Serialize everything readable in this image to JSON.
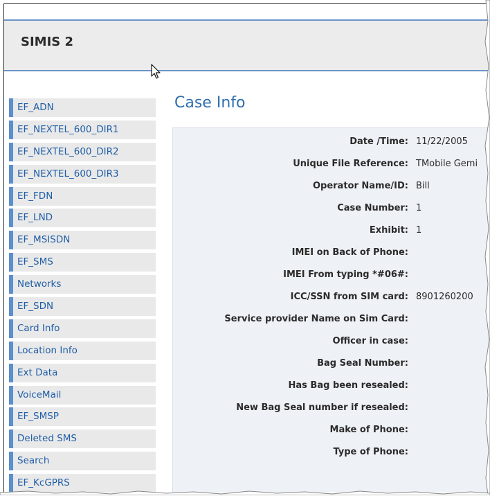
{
  "app": {
    "title": "SIMIS 2"
  },
  "sidebar": {
    "items": [
      {
        "label": "EF_ADN"
      },
      {
        "label": "EF_NEXTEL_600_DIR1"
      },
      {
        "label": "EF_NEXTEL_600_DIR2"
      },
      {
        "label": "EF_NEXTEL_600_DIR3"
      },
      {
        "label": "EF_FDN"
      },
      {
        "label": "EF_LND"
      },
      {
        "label": "EF_MSISDN"
      },
      {
        "label": "EF_SMS"
      },
      {
        "label": "Networks"
      },
      {
        "label": "EF_SDN"
      },
      {
        "label": "Card Info"
      },
      {
        "label": "Location Info"
      },
      {
        "label": "Ext Data"
      },
      {
        "label": "VoiceMail"
      },
      {
        "label": "EF_SMSP"
      },
      {
        "label": "Deleted SMS"
      },
      {
        "label": "Search"
      },
      {
        "label": "EF_KcGPRS"
      }
    ]
  },
  "main": {
    "title": "Case Info",
    "fields": [
      {
        "label": "Date /Time:",
        "value": "11/22/2005"
      },
      {
        "label": "Unique File Reference:",
        "value": "TMobile Gemi"
      },
      {
        "label": "Operator Name/ID:",
        "value": "Bill"
      },
      {
        "label": "Case Number:",
        "value": "1"
      },
      {
        "label": "Exhibit:",
        "value": "1"
      },
      {
        "label": "IMEI on Back of Phone:",
        "value": ""
      },
      {
        "label": "IMEI From typing *#06#:",
        "value": ""
      },
      {
        "label": "ICC/SSN from SIM card:",
        "value": "8901260200"
      },
      {
        "label": "Service provider Name on Sim Card:",
        "value": ""
      },
      {
        "label": "Officer in case:",
        "value": ""
      },
      {
        "label": "Bag Seal Number:",
        "value": ""
      },
      {
        "label": "Has Bag been resealed:",
        "value": ""
      },
      {
        "label": "New Bag Seal number if resealed:",
        "value": ""
      },
      {
        "label": "Make of Phone:",
        "value": ""
      },
      {
        "label": "Type of Phone:",
        "value": ""
      }
    ]
  },
  "colors": {
    "accent": "#5b8fcf",
    "link": "#1f5ea8",
    "title": "#2f6fae",
    "panel_bg": "#eef1f6",
    "header_bg": "#ececec"
  }
}
